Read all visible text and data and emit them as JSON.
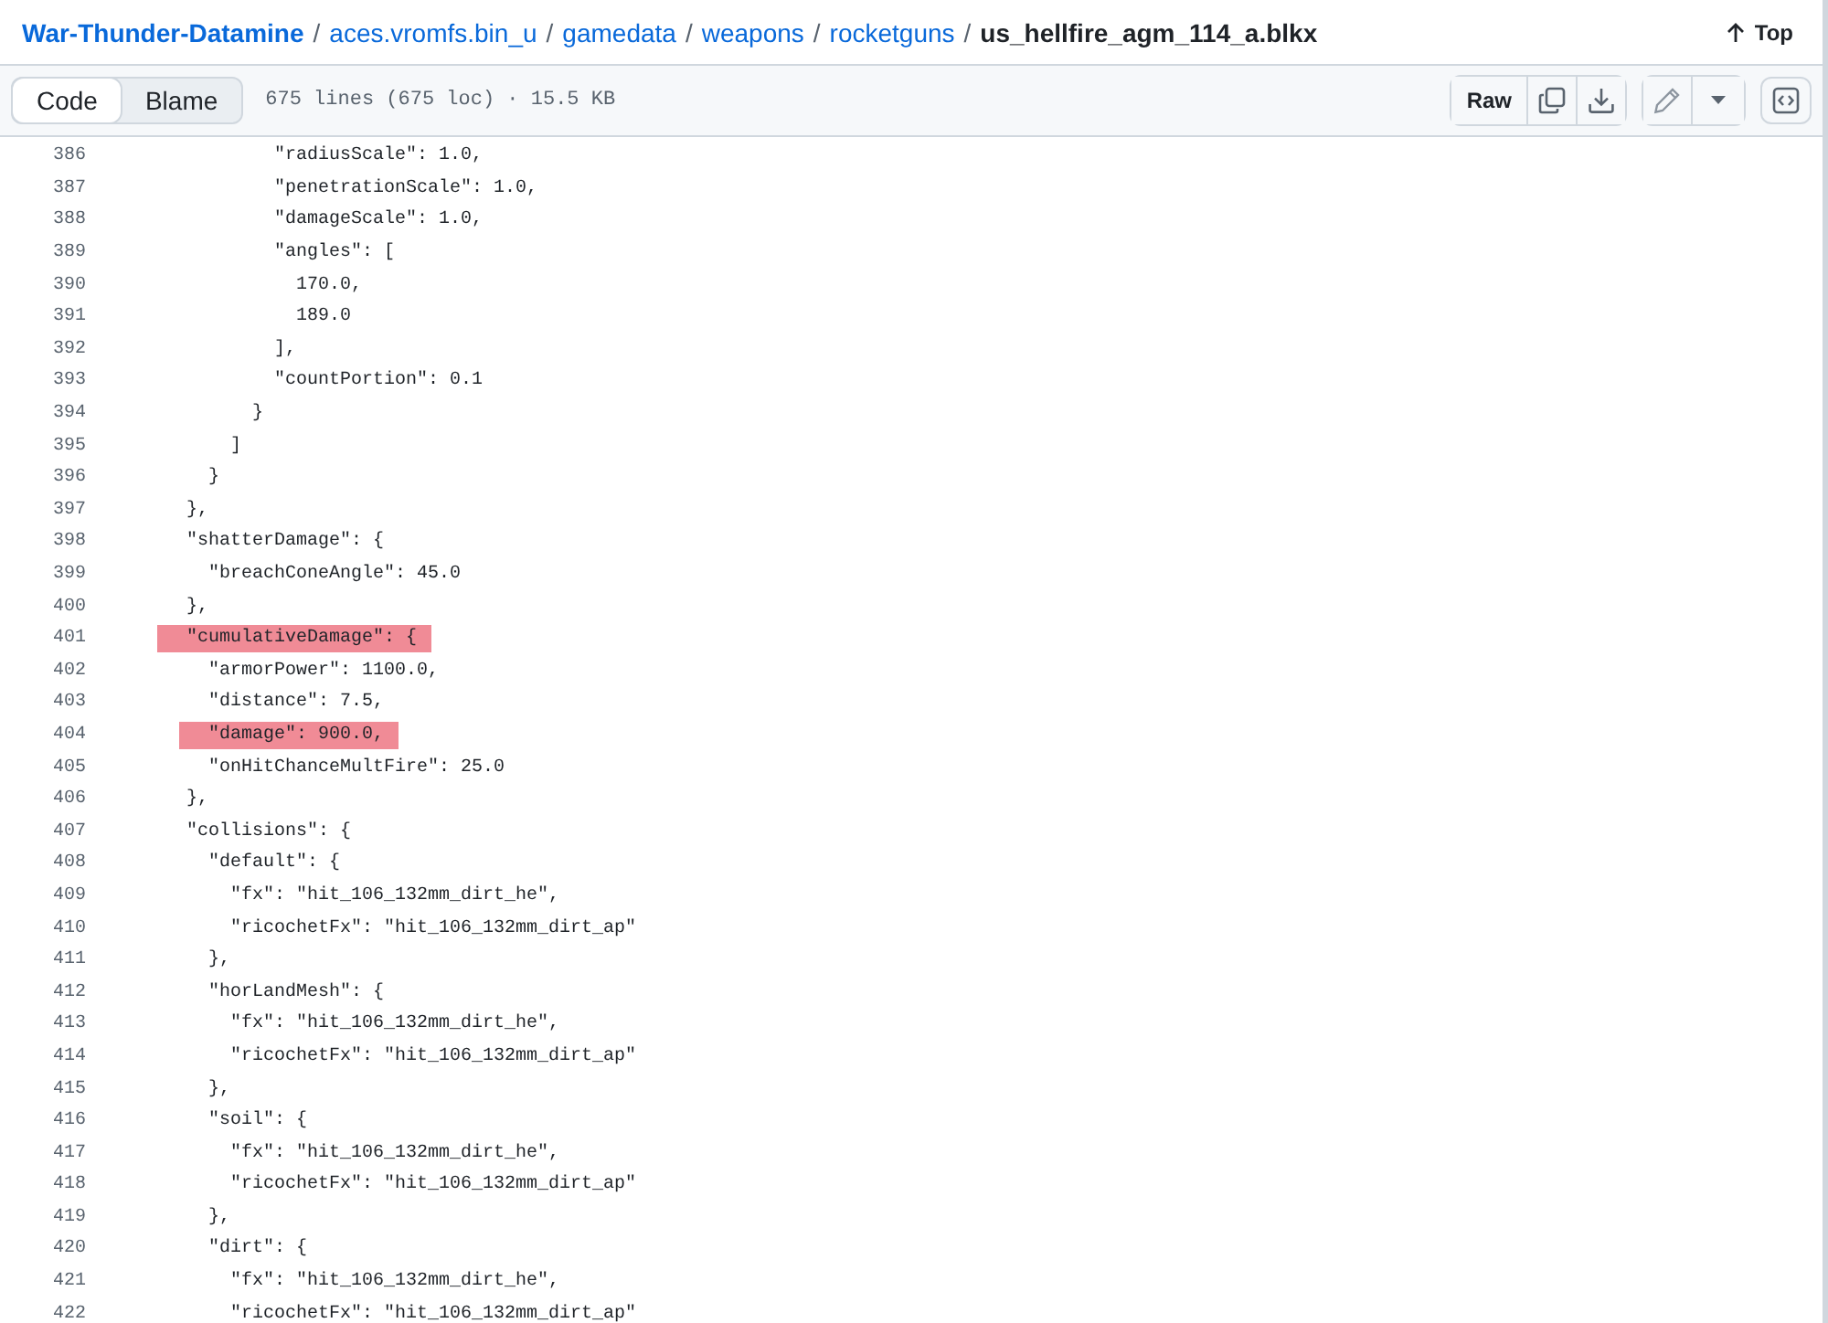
{
  "breadcrumb": {
    "separator": "/",
    "items": [
      {
        "label": "War-Thunder-Datamine",
        "kind": "repo"
      },
      {
        "label": "aces.vromfs.bin_u",
        "kind": "dir"
      },
      {
        "label": "gamedata",
        "kind": "dir"
      },
      {
        "label": "weapons",
        "kind": "dir"
      },
      {
        "label": "rocketguns",
        "kind": "dir"
      },
      {
        "label": "us_hellfire_agm_114_a.blkx",
        "kind": "file"
      }
    ]
  },
  "top_button": {
    "label": "Top"
  },
  "tabs": [
    {
      "label": "Code",
      "selected": true
    },
    {
      "label": "Blame",
      "selected": false
    }
  ],
  "file_info": "675 lines (675 loc) · 15.5 KB",
  "raw_button": {
    "label": "Raw"
  },
  "code_lines": [
    {
      "number": "386",
      "code": "            \"radiusScale\": 1.0,",
      "highlighted": false
    },
    {
      "number": "387",
      "code": "            \"penetrationScale\": 1.0,",
      "highlighted": false
    },
    {
      "number": "388",
      "code": "            \"damageScale\": 1.0,",
      "highlighted": false
    },
    {
      "number": "389",
      "code": "            \"angles\": [",
      "highlighted": false
    },
    {
      "number": "390",
      "code": "              170.0,",
      "highlighted": false
    },
    {
      "number": "391",
      "code": "              189.0",
      "highlighted": false
    },
    {
      "number": "392",
      "code": "            ],",
      "highlighted": false
    },
    {
      "number": "393",
      "code": "            \"countPortion\": 0.1",
      "highlighted": false
    },
    {
      "number": "394",
      "code": "          }",
      "highlighted": false
    },
    {
      "number": "395",
      "code": "        ]",
      "highlighted": false
    },
    {
      "number": "396",
      "code": "      }",
      "highlighted": false
    },
    {
      "number": "397",
      "code": "    },",
      "highlighted": false
    },
    {
      "number": "398",
      "code": "    \"shatterDamage\": {",
      "highlighted": false
    },
    {
      "number": "399",
      "code": "      \"breachConeAngle\": 45.0",
      "highlighted": false
    },
    {
      "number": "400",
      "code": "    },",
      "highlighted": false
    },
    {
      "number": "401",
      "code": "    \"cumulativeDamage\": {",
      "highlighted": true
    },
    {
      "number": "402",
      "code": "      \"armorPower\": 1100.0,",
      "highlighted": false
    },
    {
      "number": "403",
      "code": "      \"distance\": 7.5,",
      "highlighted": false
    },
    {
      "number": "404",
      "code": "      \"damage\": 900.0,",
      "highlighted": true
    },
    {
      "number": "405",
      "code": "      \"onHitChanceMultFire\": 25.0",
      "highlighted": false
    },
    {
      "number": "406",
      "code": "    },",
      "highlighted": false
    },
    {
      "number": "407",
      "code": "    \"collisions\": {",
      "highlighted": false
    },
    {
      "number": "408",
      "code": "      \"default\": {",
      "highlighted": false
    },
    {
      "number": "409",
      "code": "        \"fx\": \"hit_106_132mm_dirt_he\",",
      "highlighted": false
    },
    {
      "number": "410",
      "code": "        \"ricochetFx\": \"hit_106_132mm_dirt_ap\"",
      "highlighted": false
    },
    {
      "number": "411",
      "code": "      },",
      "highlighted": false
    },
    {
      "number": "412",
      "code": "      \"horLandMesh\": {",
      "highlighted": false
    },
    {
      "number": "413",
      "code": "        \"fx\": \"hit_106_132mm_dirt_he\",",
      "highlighted": false
    },
    {
      "number": "414",
      "code": "        \"ricochetFx\": \"hit_106_132mm_dirt_ap\"",
      "highlighted": false
    },
    {
      "number": "415",
      "code": "      },",
      "highlighted": false
    },
    {
      "number": "416",
      "code": "      \"soil\": {",
      "highlighted": false
    },
    {
      "number": "417",
      "code": "        \"fx\": \"hit_106_132mm_dirt_he\",",
      "highlighted": false
    },
    {
      "number": "418",
      "code": "        \"ricochetFx\": \"hit_106_132mm_dirt_ap\"",
      "highlighted": false
    },
    {
      "number": "419",
      "code": "      },",
      "highlighted": false
    },
    {
      "number": "420",
      "code": "      \"dirt\": {",
      "highlighted": false
    },
    {
      "number": "421",
      "code": "        \"fx\": \"hit_106_132mm_dirt_he\",",
      "highlighted": false
    },
    {
      "number": "422",
      "code": "        \"ricochetFx\": \"hit_106_132mm_dirt_ap\"",
      "highlighted": false
    }
  ]
}
